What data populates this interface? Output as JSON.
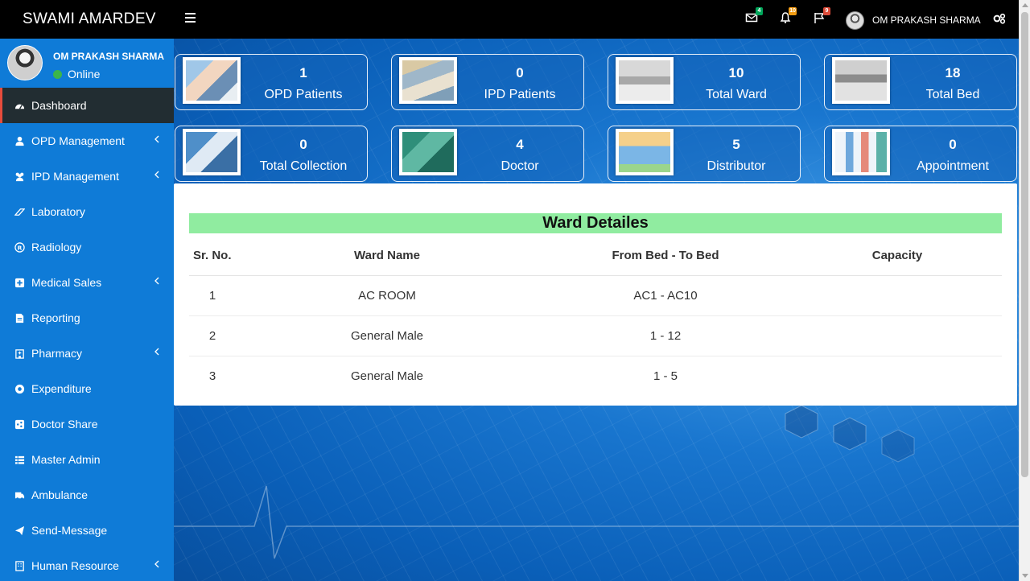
{
  "topbar": {
    "brand": "SWAMI AMARDEV",
    "badges": {
      "mail": "4",
      "bell": "10",
      "flag": "9"
    },
    "user_name": "OM PRAKASH SHARMA"
  },
  "sidebar": {
    "user_name": "OM PRAKASH SHARMA",
    "status": "Online",
    "items": [
      {
        "label": "Dashboard",
        "icon": "dashboard-icon"
      },
      {
        "label": "OPD Management",
        "icon": "user-icon"
      },
      {
        "label": "IPD Management",
        "icon": "users-icon"
      },
      {
        "label": "Laboratory",
        "icon": "eraser-icon"
      },
      {
        "label": "Radiology",
        "icon": "registered-icon"
      },
      {
        "label": "Medical Sales",
        "icon": "plus-square-icon"
      },
      {
        "label": "Reporting",
        "icon": "file-icon"
      },
      {
        "label": "Pharmacy",
        "icon": "hospital-icon"
      },
      {
        "label": "Expenditure",
        "icon": "life-ring-icon"
      },
      {
        "label": "Doctor Share",
        "icon": "share-square-icon"
      },
      {
        "label": "Master Admin",
        "icon": "th-list-icon"
      },
      {
        "label": "Ambulance",
        "icon": "ambulance-icon"
      },
      {
        "label": "Send-Message",
        "icon": "paper-plane-icon"
      },
      {
        "label": "Human Resource",
        "icon": "building-icon"
      }
    ]
  },
  "stats": [
    {
      "value": "1",
      "label": "OPD Patients"
    },
    {
      "value": "0",
      "label": "IPD Patients"
    },
    {
      "value": "10",
      "label": "Total Ward"
    },
    {
      "value": "18",
      "label": "Total Bed"
    },
    {
      "value": "0",
      "label": "Total Collection"
    },
    {
      "value": "4",
      "label": "Doctor"
    },
    {
      "value": "5",
      "label": "Distributor"
    },
    {
      "value": "0",
      "label": "Appointment"
    }
  ],
  "ward": {
    "title": "Ward Detailes",
    "headers": [
      "Sr. No.",
      "Ward Name",
      "From Bed - To Bed",
      "Capacity"
    ],
    "rows": [
      [
        "1",
        "AC ROOM",
        "AC1 - AC10",
        ""
      ],
      [
        "2",
        "General Male",
        "1 - 12",
        ""
      ],
      [
        "3",
        "General Male",
        "1 - 5",
        ""
      ]
    ]
  },
  "colors": {
    "sidebar": "#0f7bd7",
    "active_item": "#222d32",
    "accent": "#e74c3c",
    "title_bar": "#90eca0"
  }
}
